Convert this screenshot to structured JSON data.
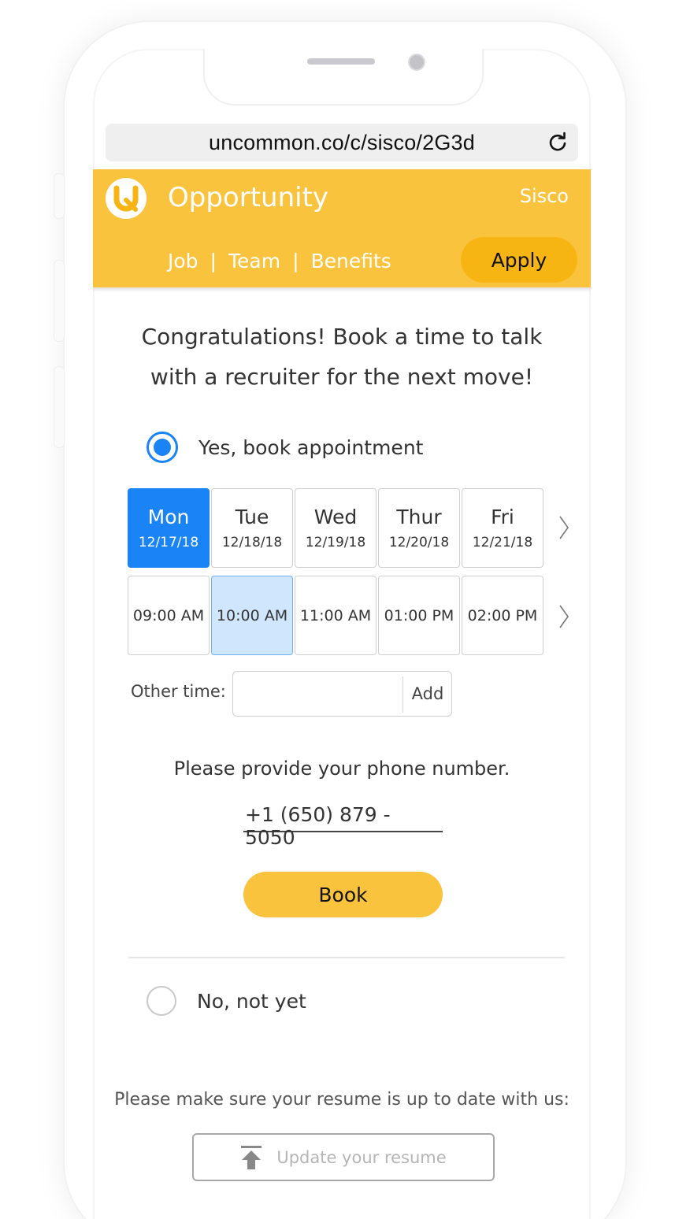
{
  "browser": {
    "url": "uncommon.co/c/sisco/2G3d"
  },
  "header": {
    "title": "Opportunity",
    "company": "Sisco",
    "nav": [
      "Job",
      "Team",
      "Benefits"
    ],
    "apply_label": "Apply"
  },
  "main": {
    "headline_line1": "Congratulations! Book a time to talk",
    "headline_line2": "with a recruiter for the next move!",
    "yes_option": {
      "label": "Yes, book appointment",
      "selected": true
    },
    "days": [
      {
        "name": "Mon",
        "date": "12/17/18",
        "selected": true
      },
      {
        "name": "Tue",
        "date": "12/18/18",
        "selected": false
      },
      {
        "name": "Wed",
        "date": "12/19/18",
        "selected": false
      },
      {
        "name": "Thur",
        "date": "12/20/18",
        "selected": false
      },
      {
        "name": "Fri",
        "date": "12/21/18",
        "selected": false
      }
    ],
    "times": [
      {
        "label": "09:00 AM",
        "selected": false
      },
      {
        "label": "10:00 AM",
        "selected": true
      },
      {
        "label": "11:00 AM",
        "selected": false
      },
      {
        "label": "01:00 PM",
        "selected": false
      },
      {
        "label": "02:00 PM",
        "selected": false
      }
    ],
    "other_time": {
      "label": "Other time:",
      "value": "",
      "add_label": "Add"
    },
    "phone_prompt": "Please provide your phone number.",
    "phone_value": "+1 (650) 879 - 5050",
    "book_label": "Book",
    "no_option": {
      "label": "No, not yet",
      "selected": false
    },
    "resume_note": "Please make sure your resume is up to date with us:",
    "resume_button": "Update your resume"
  },
  "colors": {
    "brand_yellow": "#f9c33e",
    "apply_yellow": "#f7b514",
    "accent_blue": "#1a83f5",
    "selected_time_bg": "#cfe6fd"
  },
  "icons": [
    "reload-icon",
    "uncommon-logo",
    "chevron-right-icon",
    "upload-icon"
  ]
}
